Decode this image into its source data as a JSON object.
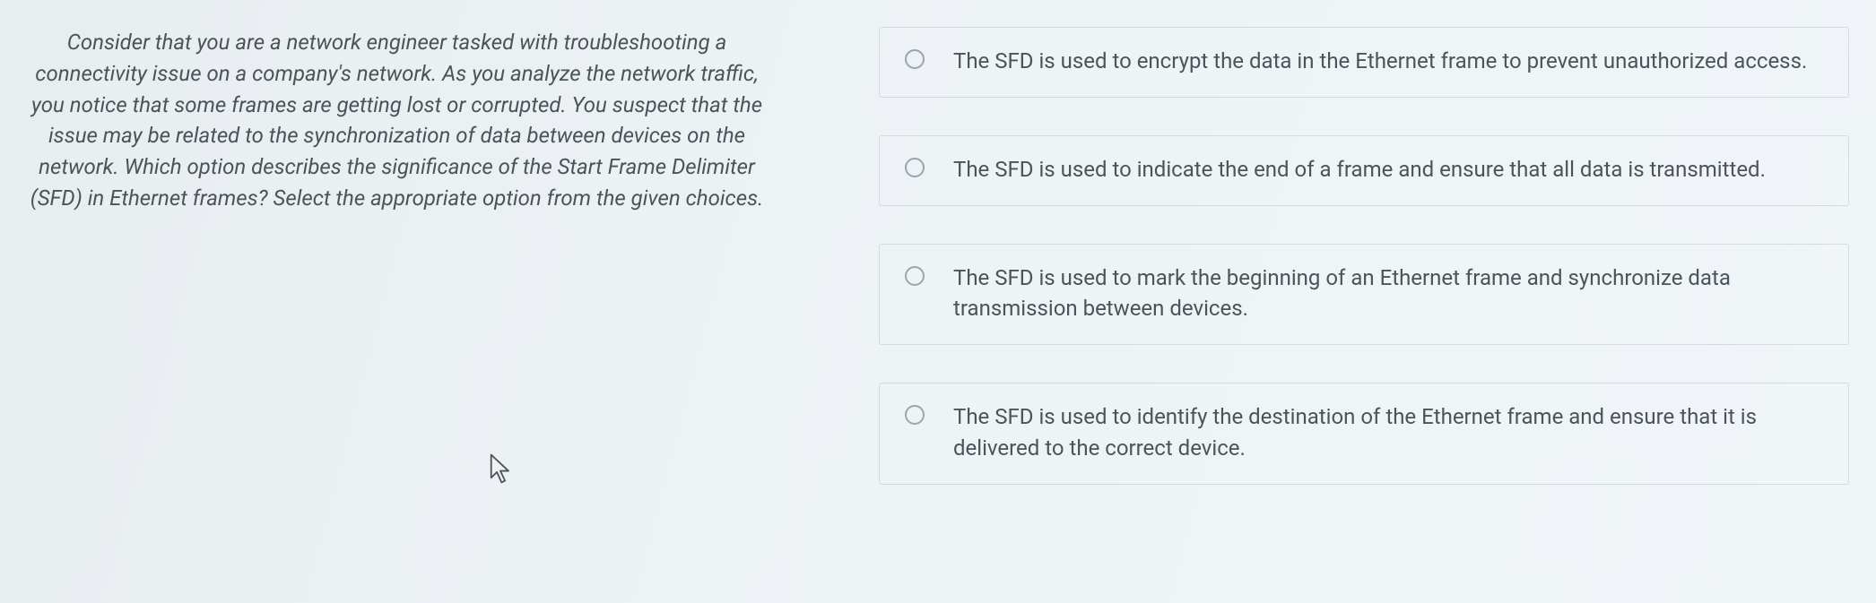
{
  "question": {
    "text": "Consider that you are a network engineer tasked with troubleshooting a connectivity issue on a company's network. As you analyze the network traffic, you notice that some frames are getting lost or corrupted. You suspect that the issue may be related to the synchronization of data between devices on the network. Which option describes the significance of the Start Frame Delimiter (SFD) in Ethernet frames? Select the appropriate option from the given choices."
  },
  "options": [
    {
      "text": "The SFD is used to encrypt the data in the Ethernet frame to prevent unauthorized access."
    },
    {
      "text": "The SFD is used to indicate the end of a frame and ensure that all data is transmitted."
    },
    {
      "text": "The SFD is used to mark the beginning of an Ethernet frame and synchronize data transmission between devices."
    },
    {
      "text": "The SFD is used to identify the destination of the Ethernet frame and ensure that it is delivered to the correct device."
    }
  ]
}
